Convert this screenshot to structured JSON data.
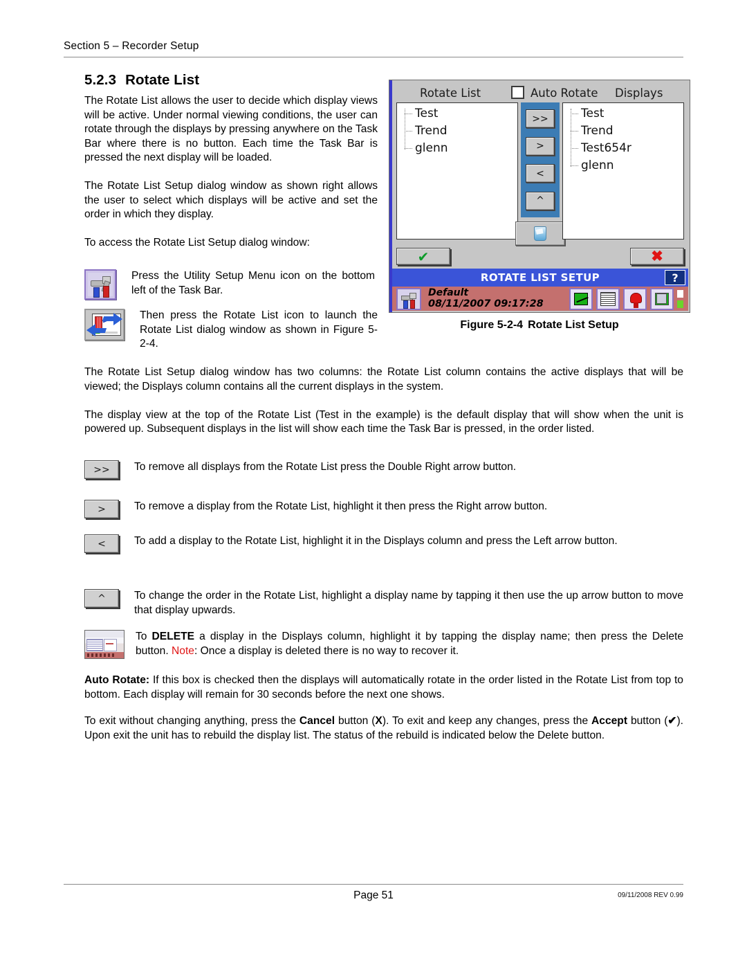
{
  "header": {
    "section": "Section 5 – Recorder Setup"
  },
  "section_title": {
    "number": "5.2.3",
    "text": "Rotate List"
  },
  "intro": {
    "p1": "The Rotate List allows the user to decide which display views will be active. Under normal viewing conditions, the user can rotate through the displays by pressing anywhere on the Task Bar where there is no button. Each time the Task Bar is pressed the next display will be loaded.",
    "p2": "The Rotate List Setup dialog window as shown right allows the user to select which displays will be active and set the order in which they display.",
    "p3": "To access the Rotate List Setup dialog window:"
  },
  "access_steps": [
    {
      "icon": "utility-setup-menu-icon",
      "text": "Press the Utility Setup Menu icon on the bottom left of the Task Bar."
    },
    {
      "icon": "rotate-list-icon",
      "text": "Then press the Rotate List icon to launch the Rotate List dialog window as shown in Figure 5-2-4."
    }
  ],
  "figure": {
    "caption_number": "Figure 5-2-4",
    "caption_text": "Rotate List Setup",
    "dialog": {
      "title": "ROTATE LIST SETUP",
      "help_label": "?",
      "column_left_label": "Rotate List",
      "column_right_label": "Displays",
      "auto_rotate_label": "Auto Rotate",
      "auto_rotate_checked": false,
      "rotate_list_items": [
        "Test",
        "Trend",
        "glenn"
      ],
      "displays_items": [
        "Test",
        "Trend",
        "Test654r",
        "glenn"
      ],
      "transfer_buttons": [
        {
          "label": ">>",
          "name": "double-right-arrow-button"
        },
        {
          "label": ">",
          "name": "right-arrow-button"
        },
        {
          "label": "<",
          "name": "left-arrow-button"
        },
        {
          "label": "^",
          "name": "up-arrow-button"
        }
      ],
      "delete_button_icon": "trash-icon",
      "accept_button_icon": "check-icon",
      "cancel_button_icon": "x-icon",
      "taskbar": {
        "display_name": "Default",
        "timestamp": "08/11/2007 09:17:28",
        "icons": [
          "trend-chart-icon",
          "data-table-icon",
          "alarm-bell-icon",
          "save-disk-icon"
        ]
      }
    },
    "colors": {
      "titlebar": "#3a54d8",
      "taskbar": "#c4706e",
      "arrow_panel": "#3c7cb4",
      "dialog_face": "#c6c6c6"
    }
  },
  "body": {
    "p1": "The Rotate List Setup dialog window has two columns: the Rotate List column contains the active displays that will be viewed; the Displays column contains all the current displays in the system.",
    "p2": "The display view at the top of the Rotate List (Test in the example) is the default display that will show when the unit is powered up. Subsequent displays in the list will show each time the Task Bar is pressed, in the order listed."
  },
  "button_rows": [
    {
      "button_label": ">>",
      "button_name": "double-right-arrow-button",
      "text": "To remove all displays from the Rotate List press the Double Right arrow button."
    },
    {
      "button_label": ">",
      "button_name": "right-arrow-button",
      "text": "To remove a display from the Rotate List, highlight it then press the Right arrow button."
    },
    {
      "button_label": "<",
      "button_name": "left-arrow-button",
      "text": "To add a display to the Rotate List, highlight it in the Displays column and press the Left arrow button."
    },
    {
      "button_label": "^",
      "button_name": "up-arrow-button",
      "text": "To change the order in the Rotate List, highlight a display name by tapping it then use the up arrow button to move that display upwards."
    }
  ],
  "delete_row": {
    "icon": "delete-display-screenshot-icon",
    "text_1": "To ",
    "bold_1": "DELETE",
    "text_2": " a display in the Displays column, highlight it by tapping the display name; then press the Delete button.  ",
    "note_label": "Note",
    "text_3": ": Once a display is deleted there is no way to recover it."
  },
  "auto_rotate_para": {
    "bold_label": "Auto Rotate:",
    "text": " If this box is checked then the displays will automatically rotate in the order listed in the Rotate List from top to bottom. Each display will remain for 30 seconds before the next one shows."
  },
  "exit_para": {
    "t1": "To exit without changing anything, press the ",
    "b1": "Cancel",
    "t2": " button  (",
    "b2": "X",
    "t3": "). To exit and keep any changes, press the ",
    "b3": "Accept",
    "t4": " button (",
    "b4": "✔",
    "t5": "). Upon exit the unit has to rebuild the display list. The status of the rebuild is indicated below the Delete button."
  },
  "footer": {
    "page": "Page 51",
    "revision": "09/11/2008 REV 0.99"
  }
}
